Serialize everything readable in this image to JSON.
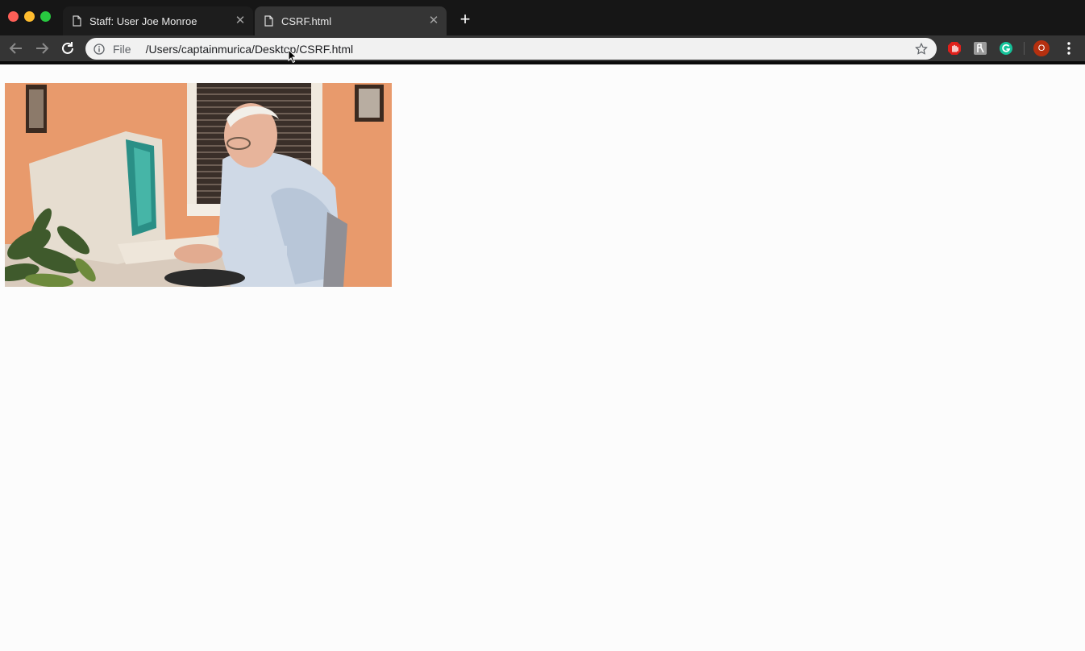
{
  "browser": {
    "tabs": [
      {
        "title": "Staff: User Joe Monroe",
        "close_glyph": "✕",
        "icon": "document-icon",
        "active": false
      },
      {
        "title": "CSRF.html",
        "close_glyph": "✕",
        "icon": "document-icon",
        "active": true
      }
    ],
    "new_tab_glyph": "+",
    "omnibox": {
      "scheme_label": "File",
      "url": "/Users/captainmurica/Desktop/CSRF.html",
      "info_icon": "info-icon",
      "bookmark_icon": "star-icon"
    },
    "extensions": [
      {
        "icon": "adblock-icon",
        "color": "#e0201b"
      },
      {
        "icon": "gray-extension-icon",
        "color": "#9b9b9b"
      },
      {
        "icon": "grammarly-icon",
        "color": "#15c39a"
      }
    ],
    "profile_badge": "O",
    "profile_color": "#b5300f",
    "menu_icon": "kebab-menu-icon"
  },
  "page": {
    "image": {
      "description_icon": "animated-gif-old-man-typing-on-computer",
      "wall_color": "#e89a6c"
    }
  }
}
